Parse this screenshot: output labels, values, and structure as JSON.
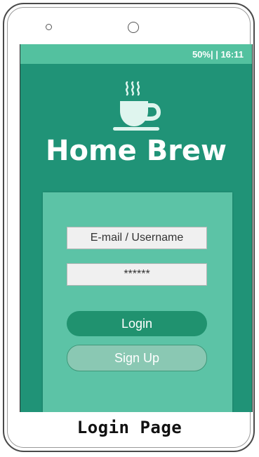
{
  "device": {
    "type": "smartphone",
    "screen_color": "#209377",
    "status_bar_color": "#53c19f"
  },
  "status_bar": {
    "text": "50%| | 16:11"
  },
  "app": {
    "icon": "coffee-cup-icon",
    "title": "Home Brew"
  },
  "login": {
    "username_placeholder": "E-mail / Username",
    "password_value": "******",
    "login_label": "Login",
    "signup_label": "Sign Up"
  },
  "caption": {
    "text": "Login Page"
  }
}
